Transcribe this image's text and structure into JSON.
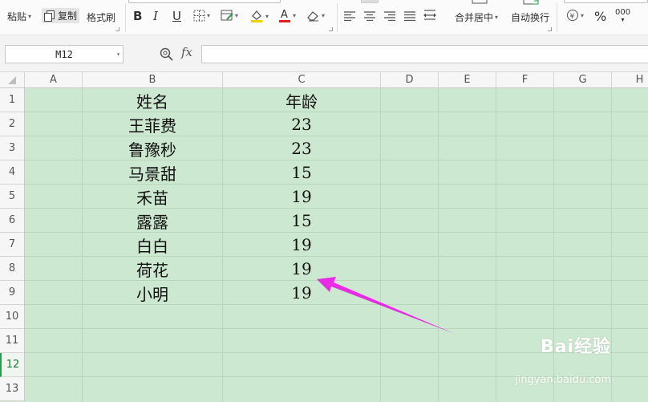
{
  "ribbon": {
    "paste_label": "粘贴",
    "copy_label": "复制",
    "format_painter_label": "格式刷",
    "merge_center_label": "合并居中",
    "wrap_text_label": "自动换行",
    "percent_label": "%",
    "decimal_label": "000",
    "font_color": "#e02020",
    "fill_color": "#f5d000"
  },
  "formula_bar": {
    "name_box": "M12",
    "fx_label": "fx",
    "formula": ""
  },
  "grid": {
    "columns": [
      "A",
      "B",
      "C",
      "D",
      "E",
      "F",
      "G",
      "H"
    ],
    "rows": [
      "1",
      "2",
      "3",
      "4",
      "5",
      "6",
      "7",
      "8",
      "9",
      "10",
      "11",
      "12",
      "13"
    ],
    "active_row": "12",
    "cell_color": "#cde8d0"
  },
  "table": {
    "header": {
      "name": "姓名",
      "age": "年龄"
    },
    "records": [
      {
        "name": "王菲费",
        "age": "23"
      },
      {
        "name": "鲁豫秒",
        "age": "23"
      },
      {
        "name": "马景甜",
        "age": "15"
      },
      {
        "name": "禾苗",
        "age": "19"
      },
      {
        "name": "露露",
        "age": "15"
      },
      {
        "name": "白白",
        "age": "19"
      },
      {
        "name": "荷花",
        "age": "19"
      },
      {
        "name": "小明",
        "age": "19"
      }
    ]
  },
  "annotation": {
    "arrow_color": "#e82ce6"
  },
  "watermark": {
    "brand": "Bai经验",
    "url": "jingyan.baidu.com"
  }
}
